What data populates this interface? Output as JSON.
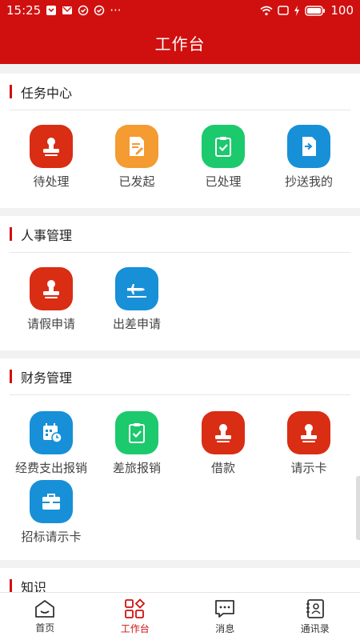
{
  "status": {
    "time": "15:25",
    "battery": "100"
  },
  "header": {
    "title": "工作台"
  },
  "sections": [
    {
      "title": "任务中心",
      "items": [
        {
          "label": "待处理",
          "icon": "stamp-icon",
          "color": "#d92d14"
        },
        {
          "label": "已发起",
          "icon": "document-edit-icon",
          "color": "#f49b31"
        },
        {
          "label": "已处理",
          "icon": "clipboard-check-icon",
          "color": "#1cc96d"
        },
        {
          "label": "抄送我的",
          "icon": "document-forward-icon",
          "color": "#1790d8"
        }
      ]
    },
    {
      "title": "人事管理",
      "items": [
        {
          "label": "请假申请",
          "icon": "stamp-icon",
          "color": "#d92d14"
        },
        {
          "label": "出差申请",
          "icon": "airplane-icon",
          "color": "#1790d8"
        }
      ]
    },
    {
      "title": "财务管理",
      "items": [
        {
          "label": "经费支出报销",
          "icon": "calendar-clock-icon",
          "color": "#1790d8"
        },
        {
          "label": "差旅报销",
          "icon": "clipboard-check-icon",
          "color": "#1cc96d"
        },
        {
          "label": "借款",
          "icon": "stamp-icon",
          "color": "#d92d14"
        },
        {
          "label": "请示卡",
          "icon": "stamp-icon",
          "color": "#d92d14"
        },
        {
          "label": "招标请示卡",
          "icon": "briefcase-icon",
          "color": "#1790d8"
        }
      ]
    },
    {
      "title": "知识"
    }
  ],
  "tabbar": [
    {
      "label": "首页",
      "icon": "home-icon",
      "active": false
    },
    {
      "label": "工作台",
      "icon": "grid-icon",
      "active": true
    },
    {
      "label": "消息",
      "icon": "message-icon",
      "active": false
    },
    {
      "label": "通讯录",
      "icon": "contacts-icon",
      "active": false
    }
  ]
}
